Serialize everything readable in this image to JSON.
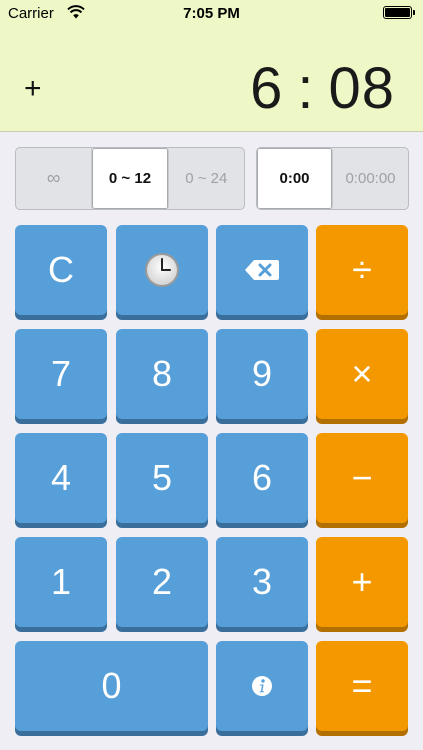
{
  "status_bar": {
    "carrier": "Carrier",
    "time": "7:05 PM",
    "wifi_icon": "wifi-icon",
    "battery_icon": "battery-icon"
  },
  "display": {
    "operator": "+",
    "hours": "6",
    "separator": ":",
    "minutes": "08"
  },
  "range_selector": {
    "options": [
      "∞",
      "0 ~ 12",
      "0 ~ 24"
    ],
    "selected": "0 ~ 12"
  },
  "format_selector": {
    "options": [
      "0:00",
      "0:00:00"
    ],
    "selected": "0:00"
  },
  "keypad": {
    "clear": "C",
    "time_key_icon": "clock-icon",
    "backspace_icon": "backspace-icon",
    "divide": "÷",
    "multiply": "×",
    "subtract": "−",
    "add": "+",
    "equals": "=",
    "digits": [
      "0",
      "1",
      "2",
      "3",
      "4",
      "5",
      "6",
      "7",
      "8",
      "9"
    ],
    "info_icon": "info-icon"
  },
  "colors": {
    "display_bg": "#eef8c6",
    "key_blue": "#579fd9",
    "key_orange": "#f49800",
    "page_bg": "#eeeef4"
  }
}
